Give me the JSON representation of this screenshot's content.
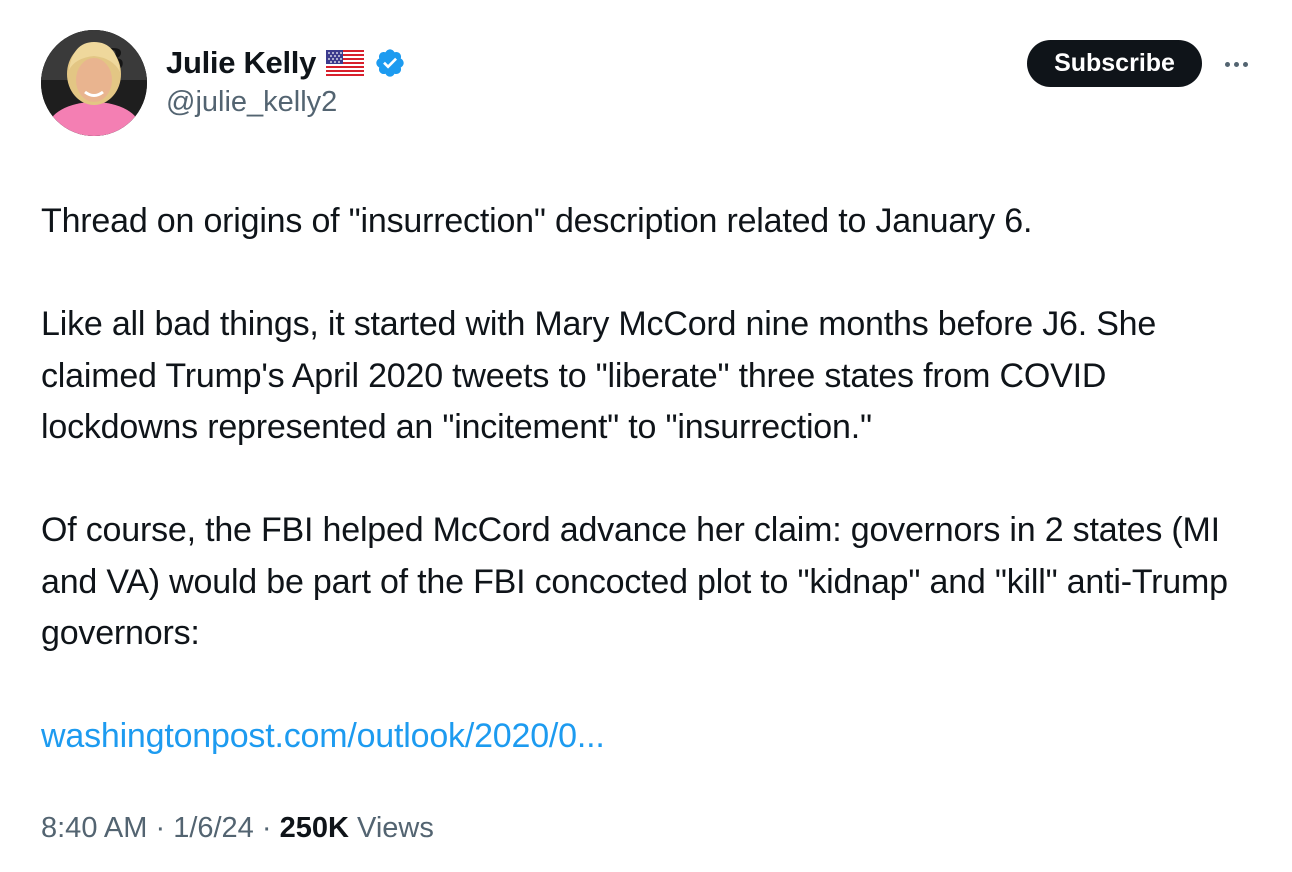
{
  "author": {
    "display_name": "Julie Kelly",
    "flag": "🇺🇸",
    "verified_icon": "verified-badge-icon",
    "handle": "@julie_kelly2",
    "avatar_icon": "avatar"
  },
  "actions": {
    "subscribe_label": "Subscribe",
    "more_icon": "more-horizontal-icon"
  },
  "tweet": {
    "paragraph_1": "Thread on origins of \"insurrection\" description related to January 6.",
    "paragraph_2": "Like all bad things, it started with Mary McCord nine months before J6. She claimed Trump's April 2020 tweets to \"liberate\" three states from COVID lockdowns represented an \"incitement\" to \"insurrection.\"",
    "paragraph_3": "Of course, the FBI helped McCord advance her claim: governors in 2 states (MI and VA) would be part of the FBI concocted plot to \"kidnap\" and \"kill\" anti-Trump governors:",
    "link_text": "washingtonpost.com/outlook/2020/0..."
  },
  "meta": {
    "time": "8:40 AM",
    "separator": " · ",
    "date": "1/6/24",
    "views_count": "250K",
    "views_label": " Views"
  },
  "colors": {
    "text": "#0f1419",
    "secondary": "#536471",
    "link": "#1d9bf0",
    "verified": "#1d9bf0",
    "button_bg": "#0f1419"
  }
}
